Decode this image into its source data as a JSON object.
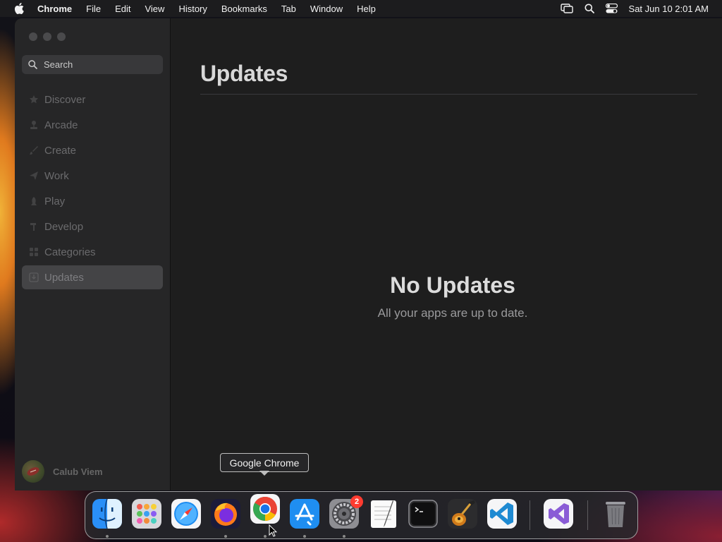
{
  "menubar": {
    "app_name": "Chrome",
    "items": [
      "File",
      "Edit",
      "View",
      "History",
      "Bookmarks",
      "Tab",
      "Window",
      "Help"
    ],
    "clock": "Sat Jun 10  2:01 AM",
    "status_icons": [
      "screen-mirroring-icon",
      "spotlight-search-icon",
      "control-center-icon"
    ]
  },
  "sidebar": {
    "search_placeholder": "Search",
    "items": [
      {
        "label": "Discover",
        "icon": "star-icon"
      },
      {
        "label": "Arcade",
        "icon": "joystick-icon"
      },
      {
        "label": "Create",
        "icon": "paintbrush-icon"
      },
      {
        "label": "Work",
        "icon": "paperplane-icon"
      },
      {
        "label": "Play",
        "icon": "rocket-icon"
      },
      {
        "label": "Develop",
        "icon": "hammer-icon"
      },
      {
        "label": "Categories",
        "icon": "grid-icon"
      },
      {
        "label": "Updates",
        "icon": "download-icon",
        "active": true
      }
    ],
    "user_name": "Calub Viem"
  },
  "main": {
    "title": "Updates",
    "empty_title": "No Updates",
    "empty_subtitle": "All your apps are up to date."
  },
  "dock": {
    "tooltip": "Google Chrome",
    "apps": [
      "Finder",
      "Launchpad",
      "Safari",
      "Firefox",
      "Google Chrome",
      "App Store",
      "System Settings",
      "TextEdit",
      "Terminal",
      "GarageBand",
      "Visual Studio Code",
      "Visual Studio",
      "Trash"
    ],
    "settings_badge": "2"
  },
  "colors": {
    "accent_red": "#ff3b30",
    "sidebar_bg": "#262627",
    "main_bg": "#1e1e1e"
  }
}
